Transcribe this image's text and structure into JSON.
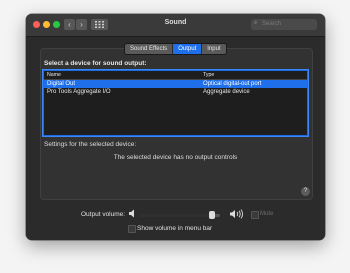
{
  "window": {
    "title": "Sound"
  },
  "search": {
    "placeholder": "Search"
  },
  "tabs": [
    {
      "label": "Sound Effects",
      "selected": false
    },
    {
      "label": "Output",
      "selected": true
    },
    {
      "label": "Input",
      "selected": false
    }
  ],
  "output": {
    "heading": "Select a device for sound output:",
    "columns": {
      "name": "Name",
      "type": "Type"
    },
    "devices": [
      {
        "name": "Digital Out",
        "type": "Optical digital-out port",
        "selected": true
      },
      {
        "name": "Pro Tools Aggregate I/O",
        "type": "Aggregate device",
        "selected": false
      }
    ],
    "settings_label": "Settings for the selected device:",
    "no_controls_message": "The selected device has no output controls"
  },
  "volume": {
    "label": "Output volume:",
    "level": 0.93,
    "mute_label": "Mute",
    "mute_checked": false,
    "show_in_menubar_label": "Show volume in menu bar",
    "show_in_menubar_checked": false
  },
  "colors": {
    "accent": "#1f6feb",
    "window_bg": "#2b2b2b",
    "close": "#fe5f57",
    "minimize": "#febc2e",
    "maximize": "#28c840"
  },
  "icons": {
    "back": "chevron-left-icon",
    "forward": "chevron-right-icon",
    "grid": "grid-icon",
    "search": "magnifier-icon",
    "help": "question-icon",
    "volume_low": "speaker-low-icon",
    "volume_high": "speaker-high-icon"
  }
}
